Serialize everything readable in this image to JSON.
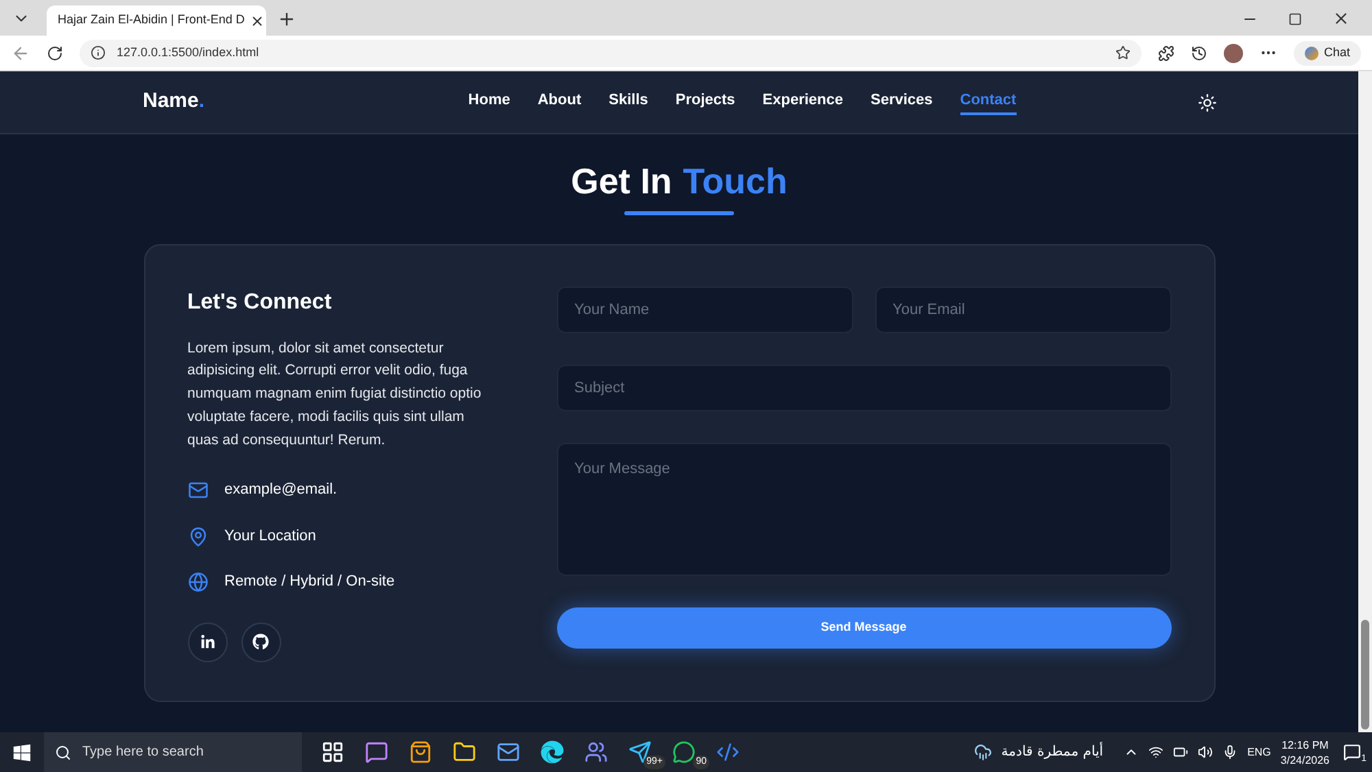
{
  "browser": {
    "tab_title": "Hajar Zain El-Abidin | Front-End D",
    "url": "127.0.0.1:5500/index.html",
    "chat_label": "Chat"
  },
  "nav": {
    "logo": "Name",
    "logo_dot": ".",
    "links": [
      {
        "label": "Home",
        "selected": false
      },
      {
        "label": "About",
        "selected": false
      },
      {
        "label": "Skills",
        "selected": false
      },
      {
        "label": "Projects",
        "selected": false
      },
      {
        "label": "Experience",
        "selected": false
      },
      {
        "label": "Services",
        "selected": false
      },
      {
        "label": "Contact",
        "selected": true
      }
    ]
  },
  "section": {
    "title": "Get In",
    "title_accent": "Touch"
  },
  "connect": {
    "heading": "Let's Connect",
    "text": "Lorem ipsum, dolor sit amet consectetur adipisicing elit. Corrupti error velit odio, fuga numquam magnam enim fugiat distinctio optio voluptate facere, modi facilis quis sint ullam quas ad consequuntur! Rerum.",
    "items": [
      {
        "kind": "email",
        "text": "example@email."
      },
      {
        "kind": "location",
        "text": "Your Location"
      },
      {
        "kind": "globe",
        "text": "Remote / Hybrid / On-site"
      }
    ],
    "socials": [
      {
        "kind": "linkedin"
      },
      {
        "kind": "github"
      }
    ]
  },
  "form": {
    "name": {
      "placeholder": "Your Name"
    },
    "email": {
      "placeholder": "Your Email"
    },
    "subject": {
      "placeholder": "Subject"
    },
    "message": {
      "placeholder": "Your Message"
    },
    "submit": "Send Message"
  },
  "taskbar": {
    "search_placeholder": "Type here to search",
    "apps": [
      {
        "kind": "taskview"
      },
      {
        "kind": "copilot"
      },
      {
        "kind": "store"
      },
      {
        "kind": "files"
      },
      {
        "kind": "mail"
      },
      {
        "kind": "edge"
      },
      {
        "kind": "teams"
      },
      {
        "kind": "telegram",
        "badge": "99+"
      },
      {
        "kind": "whatsapp",
        "badge": "90"
      },
      {
        "kind": "vscode"
      }
    ],
    "weather": "أيام ممطرة قادمة",
    "language": "ENG",
    "time": "12:16 PM",
    "date": "3/24/2026",
    "notifications": "1"
  }
}
